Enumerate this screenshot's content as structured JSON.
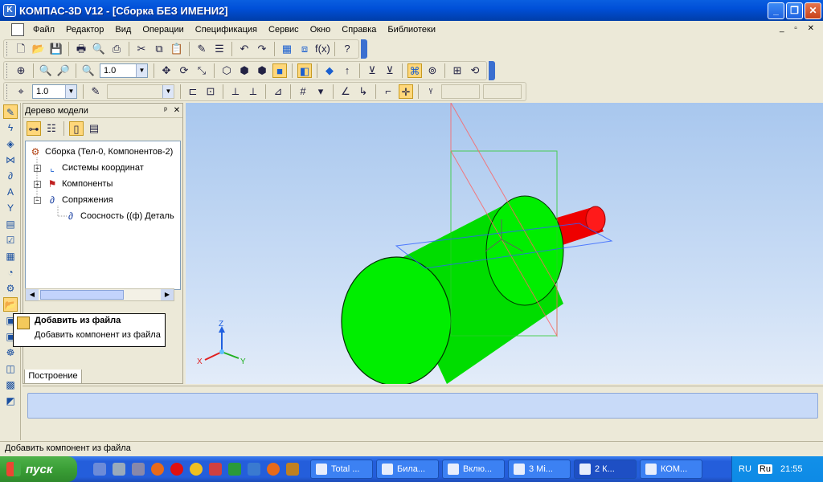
{
  "window": {
    "app_icon": "kompas-icon",
    "title": "КОМПАС-3D V12 - [Сборка БЕЗ ИМЕНИ2]",
    "controls": {
      "minimize": "_",
      "maximize": "❐",
      "close": "✕"
    }
  },
  "menu": {
    "items": [
      "Файл",
      "Редактор",
      "Вид",
      "Операции",
      "Спецификация",
      "Сервис",
      "Окно",
      "Справка",
      "Библиотеки"
    ],
    "window_controls": "_ ▫ ✕"
  },
  "toolbar_view": {
    "zoom_value": "1.0"
  },
  "toolbar_current": {
    "step_value": "1.0"
  },
  "tree": {
    "title": "Дерево модели",
    "pin_glyph": "ᵖ",
    "close_glyph": "✕",
    "root": "Сборка (Тел-0, Компонентов-2)",
    "nodes": [
      {
        "label": "Системы координат",
        "expander": "+"
      },
      {
        "label": "Компоненты",
        "expander": "+"
      },
      {
        "label": "Сопряжения",
        "expander": "−"
      },
      {
        "label": "Соосность ((ф) Деталь",
        "expander": ""
      }
    ]
  },
  "tooltip": {
    "title": "Добавить из файла",
    "description": "Добавить компонент из файла"
  },
  "bottom_tab": "Построение",
  "axes": {
    "x": "X",
    "y": "Y",
    "z": "Z"
  },
  "statusbar": {
    "text": "Добавить компонент из файла"
  },
  "taskbar": {
    "start_label": "пуск",
    "tasks": [
      {
        "label": "Total ..."
      },
      {
        "label": "Била..."
      },
      {
        "label": "Вклю..."
      },
      {
        "label": "3 Mi..."
      },
      {
        "label": "2 К..."
      },
      {
        "label": "КОМ..."
      }
    ],
    "lang": "RU",
    "lang_indicator": "Ru",
    "clock": "21:55"
  },
  "colors": {
    "cylinder": "#00ee00",
    "shaft": "#ee0000",
    "viewport_top": "#a8c7ee",
    "accent": "#245edb"
  }
}
